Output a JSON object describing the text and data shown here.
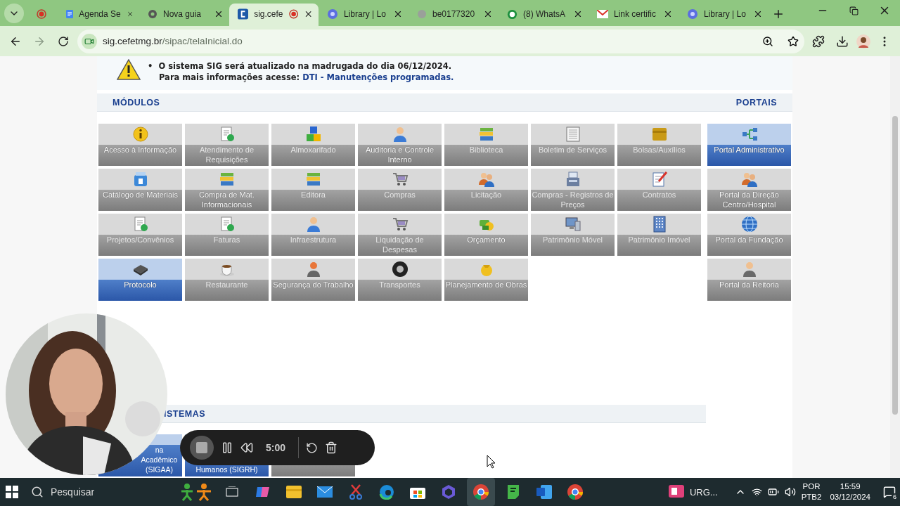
{
  "browser": {
    "tabs": [
      {
        "selected": false
      },
      {
        "title": "Agenda Se",
        "selected": false
      },
      {
        "title": "Nova guia",
        "selected": false
      },
      {
        "title": "sig.cefe",
        "selected": true
      },
      {
        "title": "Library | Lo",
        "selected": false
      },
      {
        "title": "be0177320",
        "selected": false
      },
      {
        "title": "(8) WhatsA",
        "selected": false
      },
      {
        "title": "Link certific",
        "selected": false
      },
      {
        "title": "Library | Lo",
        "selected": false
      }
    ],
    "address": {
      "domain": "sig.cefetmg.br",
      "path": "/sipac/telaInicial.do"
    }
  },
  "notice": {
    "bullet": "•",
    "line1": "O sistema SIG será atualizado na madrugada do dia 06/12/2024.",
    "line2": "Para mais informações acesse:",
    "link": "DTI - Manutenções programadas."
  },
  "modules": {
    "heading": "MÓDULOS",
    "items": [
      {
        "label": "Acesso à Informação",
        "disabled": false,
        "selected": false
      },
      {
        "label": "Atendimento de Requisições",
        "disabled": true,
        "selected": false
      },
      {
        "label": "Almoxarifado",
        "disabled": true,
        "selected": false
      },
      {
        "label": "Auditoria e Controle Interno",
        "disabled": false,
        "selected": false
      },
      {
        "label": "Biblioteca",
        "disabled": true,
        "selected": false
      },
      {
        "label": "Boletim de Serviços",
        "disabled": true,
        "selected": false
      },
      {
        "label": "Bolsas/Auxílios",
        "disabled": true,
        "selected": false
      },
      {
        "label": "Catálogo de Materiais",
        "disabled": false,
        "selected": false
      },
      {
        "label": "Compra de Mat. Informacionais",
        "disabled": false,
        "selected": false
      },
      {
        "label": "Editora",
        "disabled": true,
        "selected": false
      },
      {
        "label": "Compras",
        "disabled": true,
        "selected": false
      },
      {
        "label": "Licitação",
        "disabled": true,
        "selected": false
      },
      {
        "label": "Compras - Registros de Preços",
        "disabled": true,
        "selected": false
      },
      {
        "label": "Contratos",
        "disabled": true,
        "selected": false
      },
      {
        "label": "Projetos/Convênios",
        "disabled": true,
        "selected": false
      },
      {
        "label": "Faturas",
        "disabled": true,
        "selected": false
      },
      {
        "label": "Infraestrutura",
        "disabled": true,
        "selected": false
      },
      {
        "label": "Liquidação de Despesas",
        "disabled": true,
        "selected": false
      },
      {
        "label": "Orçamento",
        "disabled": false,
        "selected": false
      },
      {
        "label": "Patrimônio Móvel",
        "disabled": true,
        "selected": false
      },
      {
        "label": "Patrimônio Imóvel",
        "disabled": true,
        "selected": false
      },
      {
        "label": "Protocolo",
        "disabled": false,
        "selected": true
      },
      {
        "label": "Restaurante",
        "disabled": true,
        "selected": false
      },
      {
        "label": "Segurança do Trabalho",
        "disabled": false,
        "selected": false
      },
      {
        "label": "Transportes",
        "disabled": true,
        "selected": false
      },
      {
        "label": "Planejamento de Obras",
        "disabled": false,
        "selected": false
      }
    ]
  },
  "portals": {
    "heading": "PORTAIS",
    "items": [
      {
        "label": "Portal Administrativo",
        "selected": true
      },
      {
        "label": "Portal da Direção Centro/Hospital",
        "selected": false
      },
      {
        "label": "Portal da Fundação",
        "selected": false
      },
      {
        "label": "Portal da Reitoria",
        "selected": false
      }
    ]
  },
  "systems": {
    "heading": "ISTEMAS",
    "items": [
      {
        "label": "na Acadêmico (SIGAA)",
        "selected": true
      },
      {
        "label": "Humanos (SIGRH)",
        "selected": true
      },
      {
        "selected": false
      }
    ]
  },
  "recorder": {
    "timer": "5:00"
  },
  "taskbar": {
    "search_placeholder": "Pesquisar",
    "app_label": "URG...",
    "language": "POR",
    "layout": "PTB2",
    "time": "15:59",
    "date": "03/12/2024",
    "notifications": "6"
  }
}
